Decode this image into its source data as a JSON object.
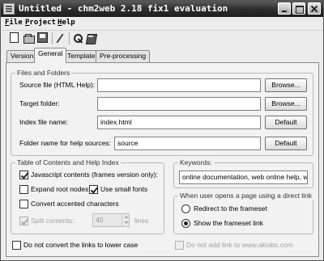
{
  "window": {
    "title": "Untitled - chm2web 2.18 fix1 evaluation"
  },
  "menu": [
    "File",
    "Project",
    "Help"
  ],
  "tabs": [
    "Version",
    "General",
    "Template",
    "Pre-processing"
  ],
  "files_group": {
    "label": "Files and Folders",
    "source_label": "Source file (HTML Help):",
    "source_value": "",
    "target_label": "Target folder:",
    "target_value": "",
    "index_label": "Index file name:",
    "index_value": "index.html",
    "folder_label": "Folder name for help sources:",
    "folder_value": "source",
    "browse_label": "Browse...",
    "default_label": "Default"
  },
  "toc_group": {
    "label": "Table of Contents and Help Index",
    "javascript": {
      "label": "Javascript contents (frames version only):",
      "checked": true
    },
    "expand_root": {
      "label": "Expand root nodes",
      "checked": false
    },
    "small_fonts": {
      "label": "Use small fonts",
      "checked": true
    },
    "convert_accented": {
      "label": "Convert accented characters",
      "checked": false
    },
    "split_contents": {
      "label": "Split contents:",
      "checked": true,
      "value": "40",
      "unit": "lines"
    }
  },
  "keywords_group": {
    "label": "Keywords:",
    "value": "online documentation, web online help, web"
  },
  "direct_link_group": {
    "label": "When user opens a page using a direct link",
    "redirect": {
      "label": "Redirect to the frameset",
      "selected": false
    },
    "show": {
      "label": "Show the frameset link",
      "selected": true
    }
  },
  "bottom": {
    "no_lowercase": {
      "label": "Do not convert the links to lower case",
      "checked": false
    },
    "no_link": {
      "label": "Do not add link to www.aklabs.com",
      "checked": false
    }
  }
}
